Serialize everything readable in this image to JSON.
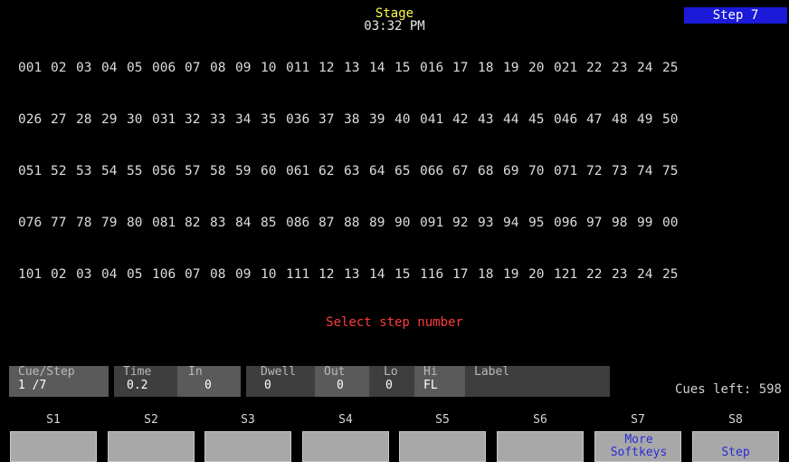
{
  "header": {
    "title": "Stage",
    "time": "03:32 PM",
    "step_badge": "Step 7"
  },
  "channel_rows": [
    [
      "001",
      "02",
      "03",
      "04",
      "05",
      "006",
      "07",
      "08",
      "09",
      "10",
      "011",
      "12",
      "13",
      "14",
      "15",
      "016",
      "17",
      "18",
      "19",
      "20",
      "021",
      "22",
      "23",
      "24",
      "25"
    ],
    [
      "026",
      "27",
      "28",
      "29",
      "30",
      "031",
      "32",
      "33",
      "34",
      "35",
      "036",
      "37",
      "38",
      "39",
      "40",
      "041",
      "42",
      "43",
      "44",
      "45",
      "046",
      "47",
      "48",
      "49",
      "50"
    ],
    [
      "051",
      "52",
      "53",
      "54",
      "55",
      "056",
      "57",
      "58",
      "59",
      "60",
      "061",
      "62",
      "63",
      "64",
      "65",
      "066",
      "67",
      "68",
      "69",
      "70",
      "071",
      "72",
      "73",
      "74",
      "75"
    ],
    [
      "076",
      "77",
      "78",
      "79",
      "80",
      "081",
      "82",
      "83",
      "84",
      "85",
      "086",
      "87",
      "88",
      "89",
      "90",
      "091",
      "92",
      "93",
      "94",
      "95",
      "096",
      "97",
      "98",
      "99",
      "00"
    ],
    [
      "101",
      "02",
      "03",
      "04",
      "05",
      "106",
      "07",
      "08",
      "09",
      "10",
      "111",
      "12",
      "13",
      "14",
      "15",
      "116",
      "17",
      "18",
      "19",
      "20",
      "121",
      "22",
      "23",
      "24",
      "25"
    ]
  ],
  "prompt": "Select step number",
  "cue_fields": [
    {
      "label": "Cue/Step",
      "value": "1  /7"
    },
    {
      "label": "Time",
      "value": "0.2"
    },
    {
      "label": "In",
      "value": "0"
    },
    {
      "label": "Dwell",
      "value": "0"
    },
    {
      "label": "Out",
      "value": "0"
    },
    {
      "label": "Lo",
      "value": "0"
    },
    {
      "label": "Hi",
      "value": "FL"
    },
    {
      "label": "Label",
      "value": ""
    }
  ],
  "cues_left": "Cues left: 598",
  "softkeys": [
    {
      "label": "S1",
      "text": ""
    },
    {
      "label": "S2",
      "text": ""
    },
    {
      "label": "S3",
      "text": ""
    },
    {
      "label": "S4",
      "text": ""
    },
    {
      "label": "S5",
      "text": ""
    },
    {
      "label": "S6",
      "text": ""
    },
    {
      "label": "S7",
      "text": "More Softkeys"
    },
    {
      "label": "S8",
      "text": "Step"
    }
  ],
  "colors": {
    "title": "#ffff4a",
    "badge_bg": "#1a1ad8",
    "prompt": "#ff3b3b",
    "softkey_text": "#2a2ad8",
    "softkey_bg": "#a8a8a8"
  }
}
